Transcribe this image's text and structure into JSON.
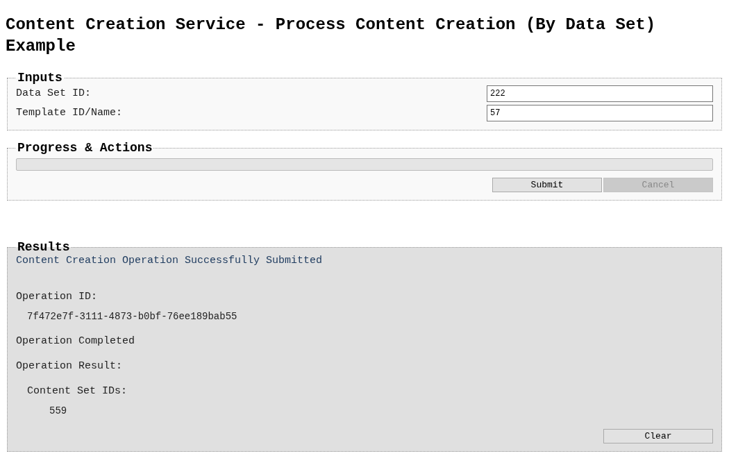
{
  "title": "Content Creation Service - Process Content Creation (By Data Set) Example",
  "inputs": {
    "legend": "Inputs",
    "fields": [
      {
        "label": "Data Set ID:",
        "value": "222"
      },
      {
        "label": "Template ID/Name:",
        "value": "57"
      }
    ]
  },
  "progress": {
    "legend": "Progress & Actions",
    "level": 0,
    "buttons": [
      {
        "label": "Submit",
        "disabled": false
      },
      {
        "label": "Cancel",
        "disabled": true
      }
    ]
  },
  "results": {
    "legend": "Results",
    "message": "Content Creation Operation Successfully Submitted",
    "operation_id_label": "Operation ID:",
    "operation_id": "7f472e7f-3111-4873-b0bf-76ee189bab55",
    "status": "Operation Completed",
    "result_label": "Operation Result:",
    "content_set_ids_label": "Content Set IDs:",
    "content_set_ids": [
      "559"
    ],
    "clear_button": {
      "label": "Clear",
      "disabled": false
    }
  }
}
